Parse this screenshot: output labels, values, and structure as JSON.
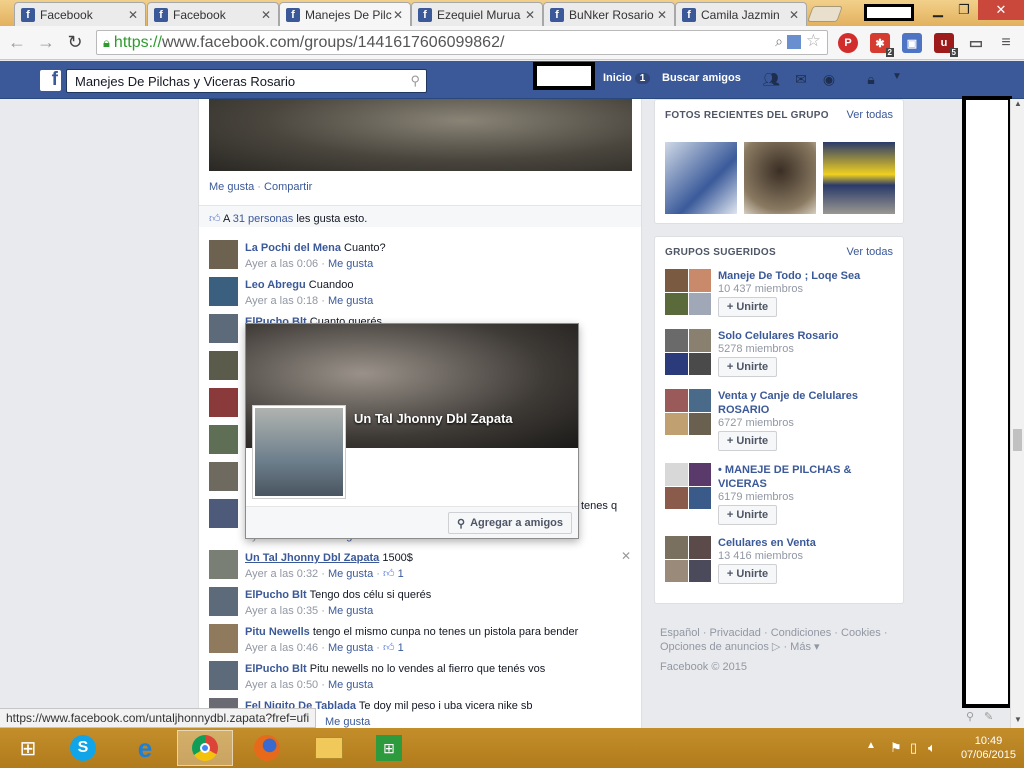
{
  "browser": {
    "tabs": [
      {
        "title": "Facebook"
      },
      {
        "title": "Facebook"
      },
      {
        "title": "Manejes De Pilchas y Viceras Rosario"
      },
      {
        "title": "Ezequiel Murua"
      },
      {
        "title": "BuNker Rosario"
      },
      {
        "title": "Camila Jazmin"
      }
    ],
    "url_https": "https://",
    "url_rest": "www.facebook.com/groups/1441617606099862/",
    "status_url": "https://www.facebook.com/untaljhonnydbl.zapata?fref=ufi",
    "ext_badges": [
      "2",
      "5"
    ]
  },
  "fb_header": {
    "search_value": "Manejes De Pilchas y Viceras Rosario",
    "home_label": "Inicio",
    "home_count": "1",
    "find_friends_label": "Buscar amigos"
  },
  "post": {
    "like_label": "Me gusta",
    "share_label": "Compartir",
    "likes_prefix": "A",
    "likes_link": "31 personas",
    "likes_suffix": "les gusta esto."
  },
  "comments": [
    {
      "name": "La Pochi del Mena",
      "text": "Cuanto?",
      "time": "Ayer a las 0:06",
      "like": "Me gusta",
      "count": ""
    },
    {
      "name": "Leo Abregu",
      "text": "Cuandoo",
      "time": "Ayer a las 0:18",
      "like": "Me gusta",
      "count": ""
    },
    {
      "name": "ElPucho Blt",
      "text": "Cuanto querés",
      "time": "",
      "like": "",
      "count": ""
    },
    {
      "name": "Un Tal Jhonny Dbl Zapata",
      "text": "1500$",
      "time": "Ayer a las 0:32",
      "like": "Me gusta",
      "count": "1"
    },
    {
      "name": "ElPucho Blt",
      "text": "Tengo dos célu si querés",
      "time": "Ayer a las 0:35",
      "like": "Me gusta",
      "count": ""
    },
    {
      "name": "Pitu Newells",
      "text": "tengo el mismo cunpa no tenes un pistola para bender",
      "time": "Ayer a las 0:46",
      "like": "Me gusta",
      "count": "1"
    },
    {
      "name": "ElPucho Blt",
      "text": "Pitu newells no lo vendes al fierro que tenés vos",
      "time": "Ayer a las 0:50",
      "like": "Me gusta",
      "count": ""
    },
    {
      "name": "Fel Nigito De Tablada",
      "text": "Te doy mil peso i uba vicera nike sb",
      "time": "",
      "like": "Me gusta",
      "count": ""
    }
  ],
  "partial_texts": {
    "tenes": "tenes q",
    "time_fragment": "Ayer a las 0:32",
    "like_fragment": "Me gusta"
  },
  "hovercard": {
    "name": "Un Tal Jhonny Dbl Zapata",
    "add_friend_label": "Agregar a amigos"
  },
  "recent_photos": {
    "title": "FOTOS RECIENTES DEL GRUPO",
    "see_all": "Ver todas"
  },
  "suggested_groups": {
    "title": "GRUPOS SUGERIDOS",
    "see_all": "Ver todas",
    "join_label": "+ Unirte",
    "items": [
      {
        "name": "Maneje De Todo ; Loqe Sea",
        "members": "10 437 miembros"
      },
      {
        "name": "Solo Celulares Rosario",
        "members": "5278 miembros"
      },
      {
        "name": "Venta y Canje de Celulares ROSARIO",
        "members": "6727 miembros"
      },
      {
        "name": "• MANEJE DE PILCHAS & VICERAS",
        "members": "6179 miembros"
      },
      {
        "name": "Celulares en Venta",
        "members": "13 416 miembros"
      }
    ]
  },
  "footer": {
    "links": [
      "Español",
      "Privacidad",
      "Condiciones",
      "Cookies",
      "Opciones de anuncios",
      "Más"
    ],
    "copyright": "Facebook © 2015"
  },
  "taskbar": {
    "time": "10:49",
    "date": "07/06/2015"
  }
}
